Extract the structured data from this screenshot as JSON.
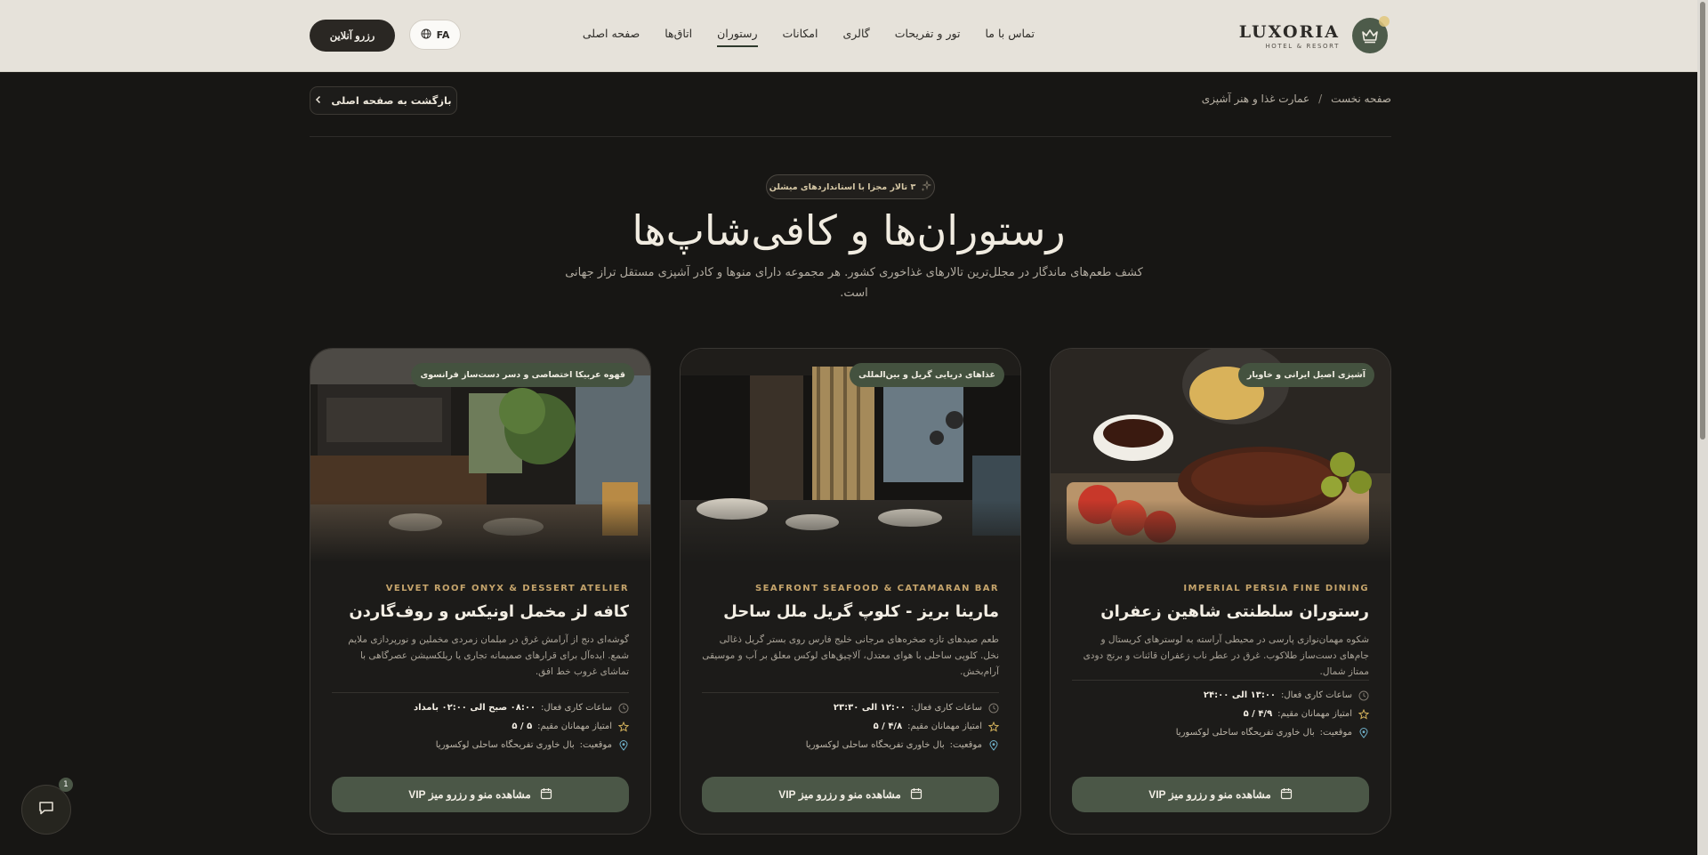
{
  "brand": {
    "name": "LUXORIA",
    "subtitle": "HOTEL & RESORT",
    "logo_icon": "crown-icon"
  },
  "nav": {
    "items": [
      {
        "label": "صفحه اصلی",
        "active": false
      },
      {
        "label": "اتاق‌ها",
        "active": false
      },
      {
        "label": "رستوران",
        "active": true
      },
      {
        "label": "امکانات",
        "active": false
      },
      {
        "label": "گالری",
        "active": false
      },
      {
        "label": "تور و تفریحات",
        "active": false
      },
      {
        "label": "تماس با ما",
        "active": false
      }
    ]
  },
  "header": {
    "language": "FA",
    "reserve_label": "رزرو آنلاین"
  },
  "breadcrumb": {
    "home": "صفحه نخست",
    "separator": "/",
    "current": "عمارت غذا و هنر آشپزی"
  },
  "back_button": {
    "label": "بازگشت به صفحه اصلی"
  },
  "hero": {
    "badge": "۳ تالار مجزا با استانداردهای میشلن",
    "title": "رستوران‌ها و کافی‌شاپ‌ها",
    "subtitle": "کشف طعم‌های ماندگار در مجلل‌ترین تالارهای غذاخوری کشور. هر مجموعه دارای منوها و کادر آشپزی مستقل تراز جهانی است."
  },
  "labels": {
    "hours": "ساعات کاری فعال:",
    "rating": "امتیاز مهمانان مقیم:",
    "location": "موقعیت:"
  },
  "restaurants": [
    {
      "tag": "آشپزی اصیل ایرانی و خاویار",
      "en_name": "IMPERIAL PERSIA FINE DINING",
      "name": "رستوران سلطنتی شاهین زعفران",
      "description": "شکوه مهمان‌نوازی پارسی در محیطی آراسته به لوسترهای کریستال و جام‌های دست‌ساز طلاکوب. غرق در عطر ناب زعفران قائنات و برنج دودی ممتاز شمال.",
      "hours": "۱۳:۰۰ الی ۲۴:۰۰",
      "rating": "۴/۹ / ۵",
      "location": "بال خاوری تفریحگاه ساحلی لوکسوریا",
      "cta": "مشاهده منو و رزرو میز VIP"
    },
    {
      "tag": "غذاهای دریایی گریل و بین‌المللی",
      "en_name": "SEAFRONT SEAFOOD & CATAMARAN BAR",
      "name": "مارینا بریز - کلوپ گریل ملل ساحل",
      "description": "طعم صیدهای تازه صخره‌های مرجانی خلیج فارس روی بستر گریل ذغالی نخل. کلوپی ساحلی با هوای معتدل، آلاچیق‌های لوکس معلق بر آب و موسیقی آرام‌بخش.",
      "hours": "۱۲:۰۰ الی ۲۳:۳۰",
      "rating": "۴/۸ / ۵",
      "location": "بال خاوری تفریحگاه ساحلی لوکسوریا",
      "cta": "مشاهده منو و رزرو میز VIP"
    },
    {
      "tag": "قهوه عربیکا اختصاصی و دسر دست‌ساز فرانسوی",
      "en_name": "VELVET ROOF ONYX & DESSERT ATELIER",
      "name": "کافه لز مخمل اونیکس و روف‌گاردن",
      "description": "گوشه‌ای دنج از آرامش غرق در مبلمان زمردی مخملین و نورپردازی ملایم شمع. ایده‌آل برای قرارهای صمیمانه تجاری یا ریلکسیشن عصرگاهی با تماشای غروب خط افق.",
      "hours": "۰۸:۰۰ صبح الی ۰۲:۰۰ بامداد",
      "rating": "۵ / ۵",
      "location": "بال خاوری تفریحگاه ساحلی لوکسوریا",
      "cta": "مشاهده منو و رزرو میز VIP"
    }
  ],
  "chat": {
    "unread": "1",
    "icon": "chat-bubble-icon"
  }
}
